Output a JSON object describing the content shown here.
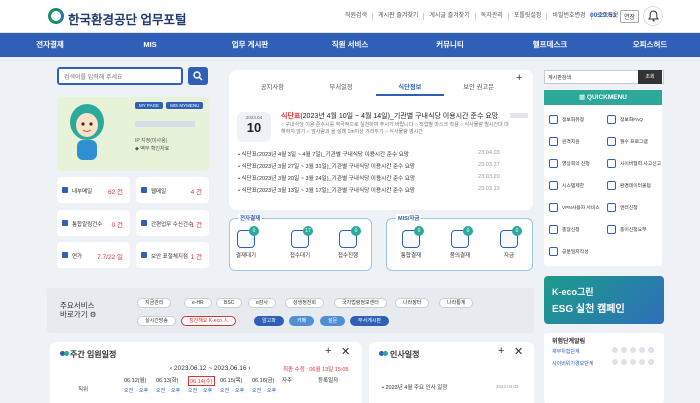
{
  "header": {
    "brand": "한국환경공단 업무포털",
    "util": [
      "직원검색",
      "게시판 즐겨찾기",
      "게시글 즐겨찾기",
      "독자관리",
      "포틀릿설정",
      "비밀번호변경",
      "로그아웃"
    ],
    "timer": "00:29:53",
    "extend": "연장"
  },
  "nav": [
    "전자결재",
    "MIS",
    "업무 게시판",
    "직원 서비스",
    "커뮤니티",
    "헬프데스크",
    "오피스허드"
  ],
  "search": {
    "placeholder": "검색어를 입력해 주세요"
  },
  "profile": {
    "tags": [
      "MY PAGE",
      "MIS MYMENU"
    ],
    "lines": [
      "IP 지정(미사용)",
      "◆ 벡무 확인자료"
    ]
  },
  "tiles": [
    {
      "label": "내부메일",
      "value": "62 건"
    },
    {
      "label": "웹메일",
      "value": "4 건"
    },
    {
      "label": "통합알림건수",
      "value": "0 건"
    },
    {
      "label": "간편업무 수신건수",
      "value": "1 건"
    },
    {
      "label": "연가",
      "value": "7.7/22 일"
    },
    {
      "label": "보안 표절체지점",
      "value": "1 건"
    }
  ],
  "tabs": [
    "공지사항",
    "부서일정",
    "식단정보",
    "보안 권고문"
  ],
  "feature": {
    "month": "2023.04",
    "day": "10",
    "title_b": "식단표",
    "title": "(2023년 4월 10일 ~ 4월 14일)_기관별 구내식당 이용시간 준수 요망",
    "desc": "○ 구내식당 이용 준수시를 적극적으로 실천하여 주시기 바랍니다 ○ 직업별 마스크 착용 ○ 식사물량 별시간대 대해하지 않기 ○ 앞사람과 올 살례 1m이상 거리두기 ○ 식사물량 영시간"
  },
  "menuRows": [
    {
      "t": "식단표(2023년 4월 3일 ~ 4월 7일)_기관별 구내식당 이용시간 준수 요망",
      "d": "23.04.03"
    },
    {
      "t": "식단표(2023년 3월 27일 ~ 3월 31일)_기관별 구내식당 이용시간 준수 요망",
      "d": "23.03.27"
    },
    {
      "t": "식단표(2023년 3월 20일 ~ 3월 24일)_기관별 구내식당 이용시간 준수 요망",
      "d": "23.03.20"
    },
    {
      "t": "식단표(2023년 3월 13일 ~ 3월 17일)_기관별 구내식당 이용시간 준수 요망",
      "d": "23.03.13"
    }
  ],
  "approval": {
    "title": "전자결재",
    "items": [
      {
        "label": "결재대기",
        "count": "0"
      },
      {
        "label": "접수대기",
        "count": "17"
      },
      {
        "label": "접수진행",
        "count": "0"
      }
    ]
  },
  "mis": {
    "title": "MIS/자금",
    "items": [
      {
        "label": "통합결재",
        "count": "0"
      },
      {
        "label": "품의결재",
        "count": "0"
      },
      {
        "label": "자금",
        "count": "0"
      }
    ]
  },
  "right": {
    "search_placeholder": "계시판검색",
    "btn": "조회",
    "qm_title": "QUICKMENU",
    "qm": [
      "정보화유정",
      "정보화FAQ",
      "원격지원",
      "월수 프로그램",
      "영상회의 신청",
      "사이버협력 사고신고",
      "시스템제한",
      "환경데이터볼텀",
      "VPN사용자 서비스",
      "엔터신청",
      "총장신청",
      "종이신청요부",
      "공문일지직성"
    ],
    "eco_a": "K-eco그린",
    "eco_b": "ESG 실천 캠페인",
    "risk_title": "위험단계알림",
    "risk": [
      "재무위험단계",
      "사이버위기경보단계"
    ]
  },
  "services": {
    "title": [
      "주요서비스",
      "바로가기"
    ],
    "chips": [
      "지금관리",
      "e-HR",
      "BSC",
      "e감사",
      "성생정전회",
      "국가법령정보센터",
      "나라장터",
      "나라통계",
      "실시간방송",
      "징잔해요 K-eco 人",
      "알고파",
      "카페",
      "설문",
      "부서게시판"
    ]
  },
  "weekly": {
    "title": "주간 임원일정",
    "range": "2023.06.12 ~ 2023.06.16",
    "updated": "최종 수정 : 06월 13일 15:05",
    "cols": [
      "직위",
      "06.12(월)",
      "06.13(화)",
      "06.14(수)",
      "06.15(목)",
      "06.16(금)",
      "자주",
      "등록일자"
    ],
    "ampm": [
      "오전",
      "오후"
    ]
  },
  "hr": {
    "title": "인사일정",
    "item": "2023년 4월 주요 인사 일정",
    "date": "2023.04.03"
  }
}
